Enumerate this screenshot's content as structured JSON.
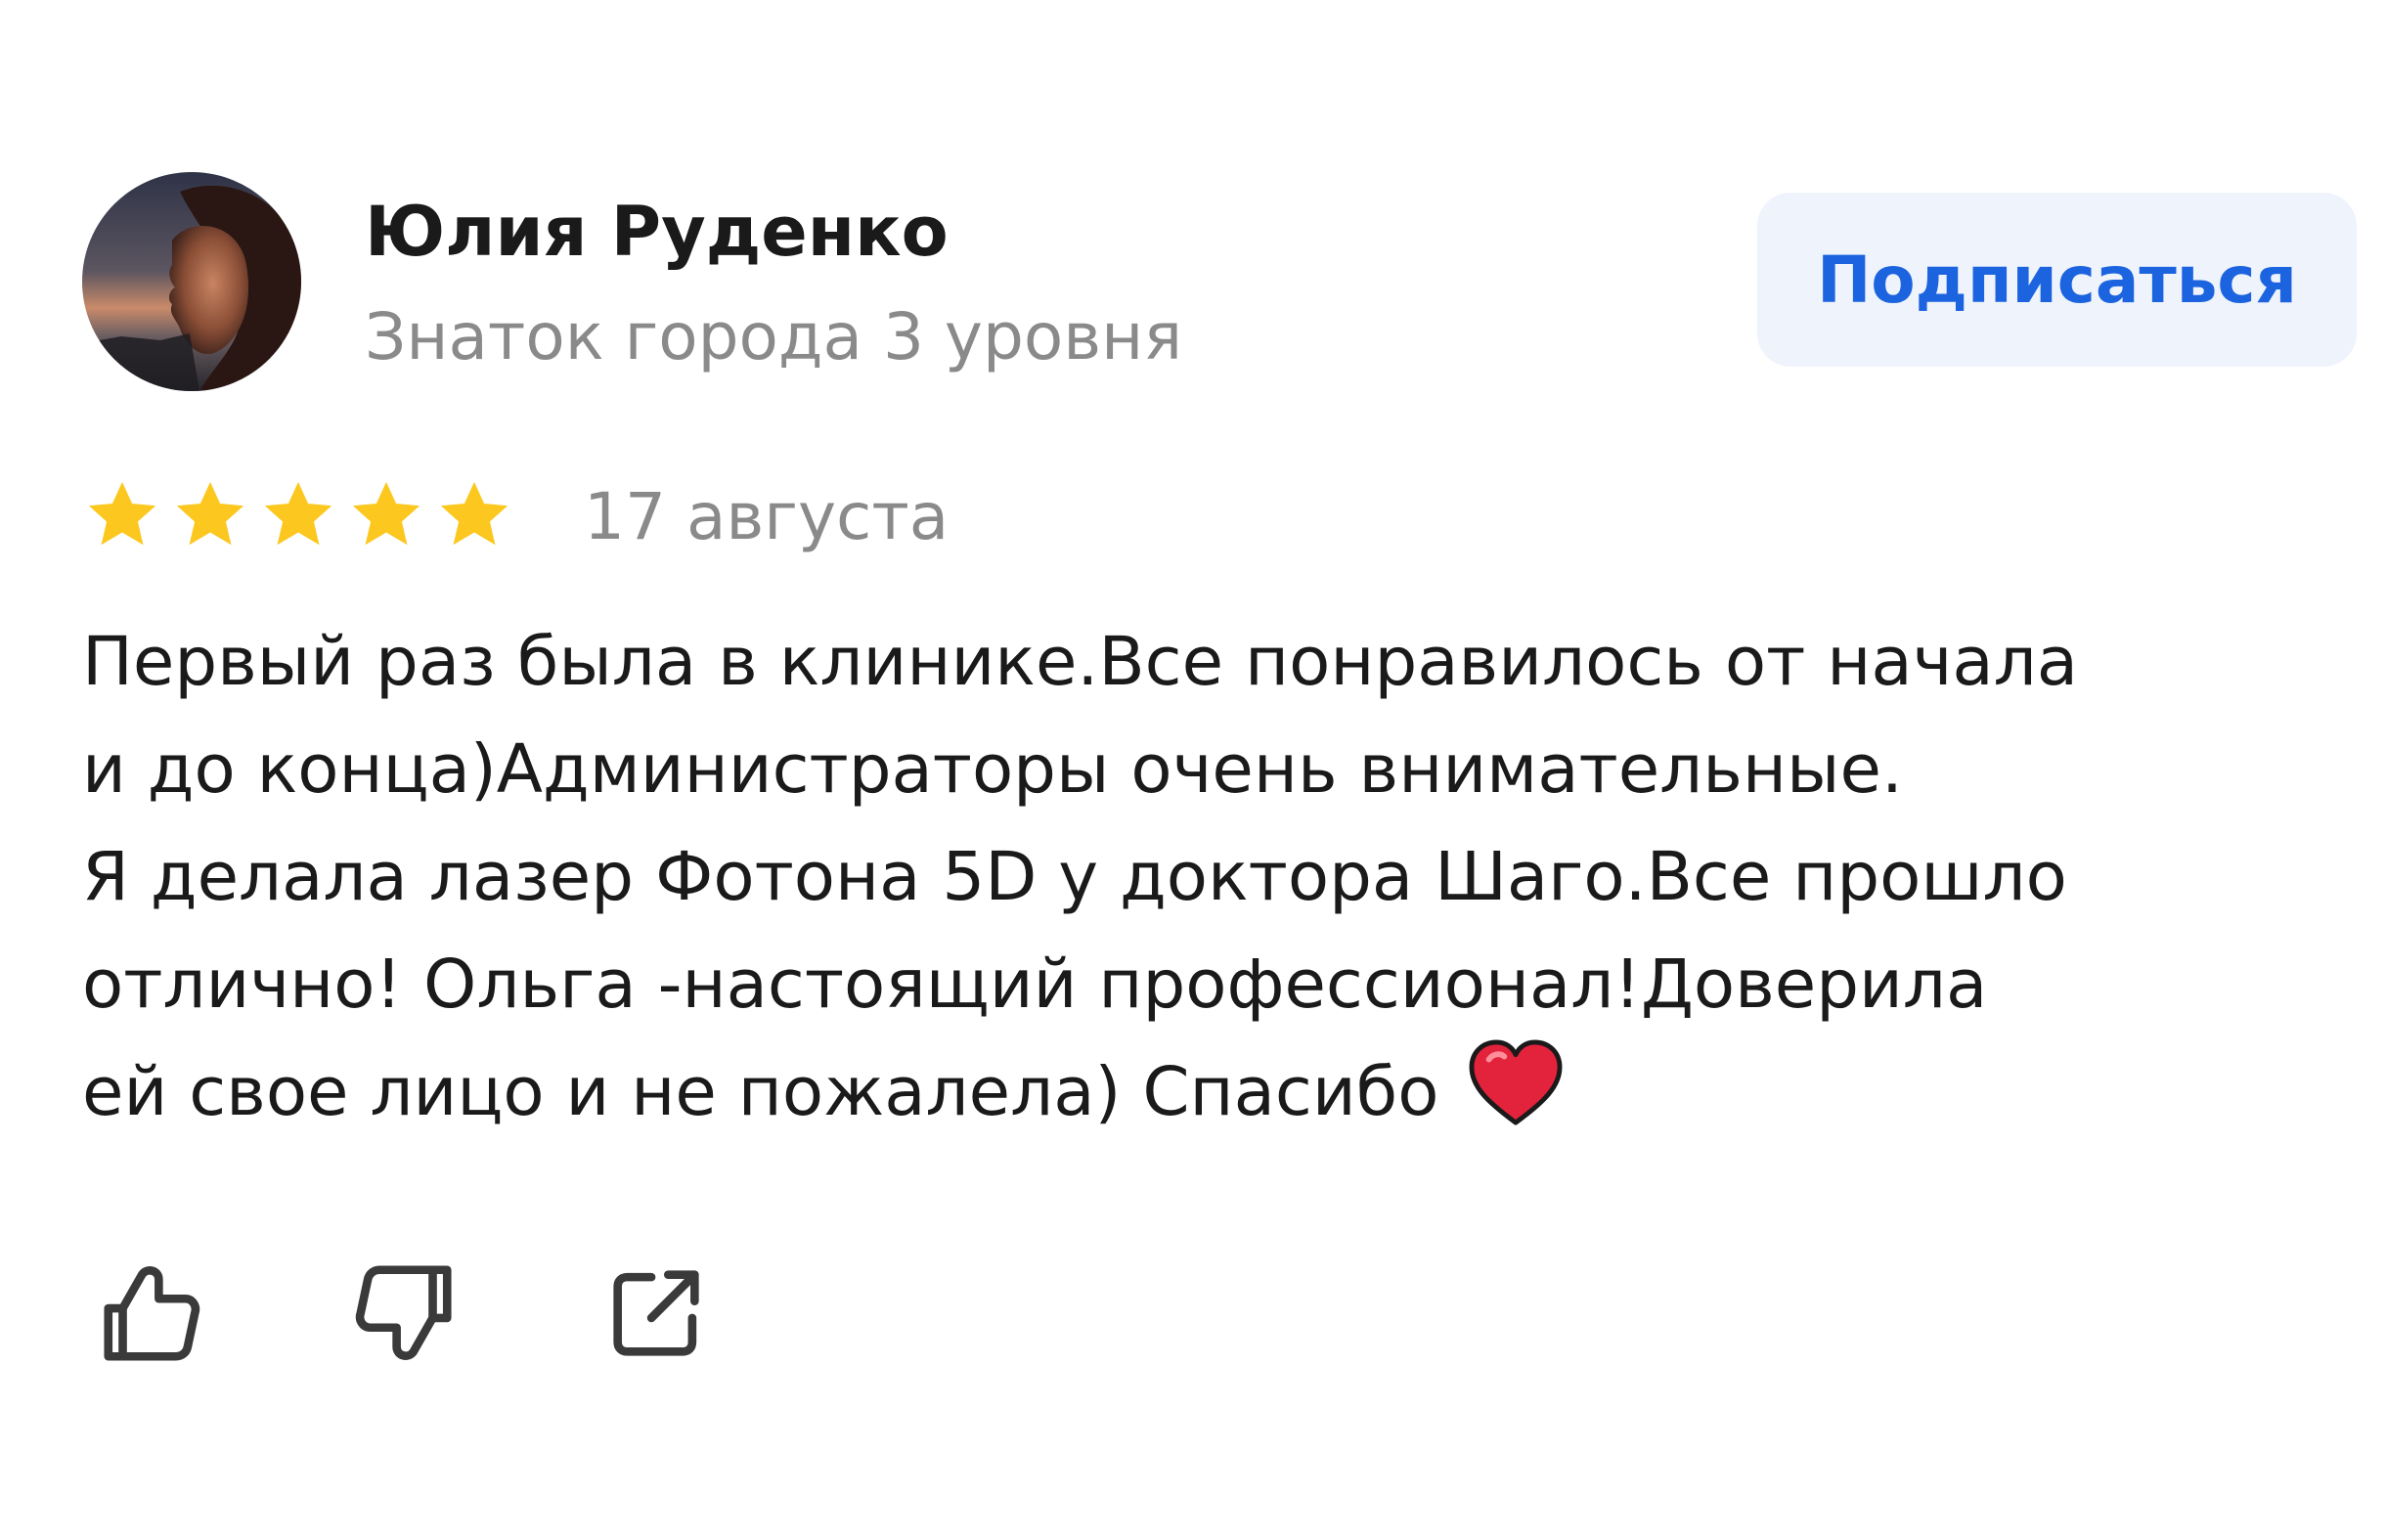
{
  "author": {
    "name": "Юлия Руденко",
    "level": "Знаток города 3 уровня",
    "avatar_icon": "person-photo"
  },
  "subscribe_button": {
    "label": "Подписаться"
  },
  "review": {
    "rating": 5,
    "rating_max": 5,
    "date": "17 августа",
    "text_lines": [
      "Первый раз была в клинике.Все понравилось от начала",
      "и до конца)Администраторы очень внимательные.",
      "Я делала лазер Фотона 5D у доктора Шаго.Все прошло",
      "отлично! Ольга -настоящий профессионал!Доверила",
      "ей свое лицо и не пожалела) Спасибо"
    ],
    "trailing_emoji": "heart-emoji"
  },
  "actions": {
    "like_icon": "thumbs-up-icon",
    "dislike_icon": "thumbs-down-icon",
    "share_icon": "share-icon"
  },
  "colors": {
    "accent": "#1c63e0",
    "button_bg": "#eef3fc",
    "star": "#fcc71e",
    "muted_text": "#8a8a8a",
    "main_text": "#1a1a1a",
    "icon": "#3a3a3a",
    "heart": "#e3223b"
  }
}
